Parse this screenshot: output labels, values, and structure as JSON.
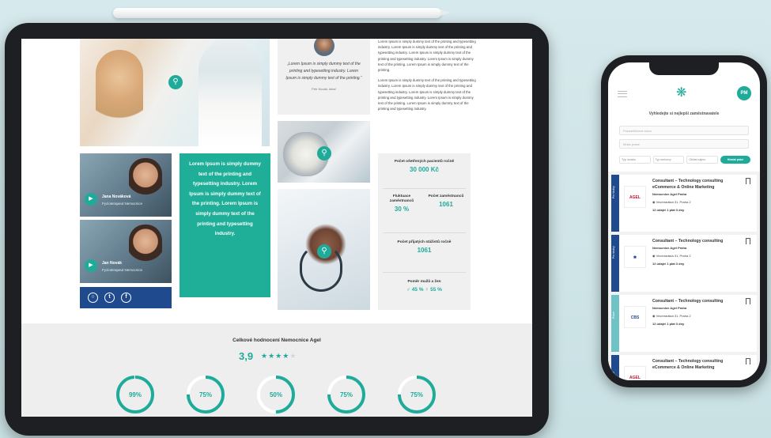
{
  "colors": {
    "accent": "#1fab9a",
    "navy": "#1f4b8e",
    "background": "#cfe4e6"
  },
  "tablet": {
    "video_cards": [
      {
        "name": "Jana Nováková",
        "role": "Fyzioterapeut Nemocnice"
      },
      {
        "name": "Jan Novák",
        "role": "Fyzioterapeut Nemocnice"
      }
    ],
    "social_icons": [
      "instagram-icon",
      "twitter-icon",
      "facebook-icon"
    ],
    "teal_quote": "Lorem Ipsum is simply dummy text of the printing and typesetting industry. Lorem Ipsum is simply dummy text of the printing. Lorem Ipsum is simply dummy text of the printing and typesetting industry.",
    "testimonial": {
      "text": "„Lorem Ipsum is simply dummy text of the printing and typesetting industry. Lorem Ipsum is simply dummy text of the printing.“",
      "author": "Petr Novák, lékař"
    },
    "lorem_paragraphs": [
      "Lorem Ipsum is simply dummy text of the printing and typesetting industry. Lorem Ipsum is simply dummy text of the printing and typesetting industry. Lorem Ipsum is simply dummy text of the printing and typesetting industry. Lorem Ipsum is simply dummy text of the printing. Lorem Ipsum is simply dummy text of the printing.",
      "Lorem Ipsum is simply dummy text of the printing and typesetting industry. Lorem Ipsum is simply dummy text of the printing and typesetting industry. Lorem Ipsum is simply dummy text of the printing and typesetting industry. Lorem Ipsum is simply dummy text of the printing. Lorem Ipsum is simply dummy text of the printing and typesetting industry."
    ],
    "stats": {
      "patients_label": "Počet ošetřených pacientů ročně",
      "patients_value": "30 000 Kč",
      "turnover_label": "Fluktuace zaměstnanců",
      "turnover_value": "30 %",
      "staff_label": "Počet zaměstnanců",
      "staff_value": "1061",
      "hires_label": "Počet přijatých stážistů ročně",
      "hires_value": "1061",
      "ratio_label": "Poměr mužů a žen",
      "ratio_value": "♂ 45 %   ♀ 55 %"
    },
    "rating": {
      "title": "Celkové hodnocení Nemocnice Agel",
      "score": "3,9",
      "stars_filled": 4,
      "stars_total": 5,
      "gauges": [
        {
          "label": "99%",
          "value": 0.99
        },
        {
          "label": "75%",
          "value": 0.75
        },
        {
          "label": "50%",
          "value": 0.5
        },
        {
          "label": "75%",
          "value": 0.75
        },
        {
          "label": "75%",
          "value": 0.75
        }
      ]
    }
  },
  "phone": {
    "avatar_initials": "PM",
    "heading": "Vyhledejte si nejlepší zaměstnavatele",
    "input1_placeholder": "Pozice/klíčové slovo",
    "input2_placeholder": "Místo práce",
    "filters": [
      "Typ úvazku",
      "Typ smlouvy",
      "Oblast zájmu"
    ],
    "search_button": "Hledat práci",
    "jobs": [
      {
        "strip": "Pro školky",
        "strip_color": "#1f4b8e",
        "logo": "AGEL",
        "logo_color": "#c8102e",
        "title": "Consultant – Technology consulting eCommerce & Online Marketing",
        "company": "Nemocnice Agel Praha",
        "location": "Vinohradská 31, Praha 2",
        "salary": "12 údaje/ 1 plat 3 dny"
      },
      {
        "strip": "Pro školky",
        "strip_color": "#1f4b8e",
        "logo": "✱",
        "logo_color": "#1f4b8e",
        "title": "Consultant – Technology consulting",
        "company": "Nemocnice Agel Praha",
        "location": "Vinohradská 31, Praha 2",
        "salary": "12 údaje/ 1 plat 3 dny"
      },
      {
        "strip": "Praxe",
        "strip_color": "#6fc3c6",
        "logo": "CBS",
        "logo_color": "#1f4b8e",
        "title": "Consultant – Technology consulting",
        "company": "Nemocnice Agel Praha",
        "location": "Vinohradská 31, Praha 2",
        "salary": "12 údaje/ 1 plat 3 dny"
      },
      {
        "strip": "Praxe",
        "strip_color": "#1f4b8e",
        "logo": "AGEL",
        "logo_color": "#c8102e",
        "title": "Consultant – Technology consulting eCommerce & Online Marketing",
        "company": "",
        "location": "",
        "salary": ""
      }
    ]
  }
}
